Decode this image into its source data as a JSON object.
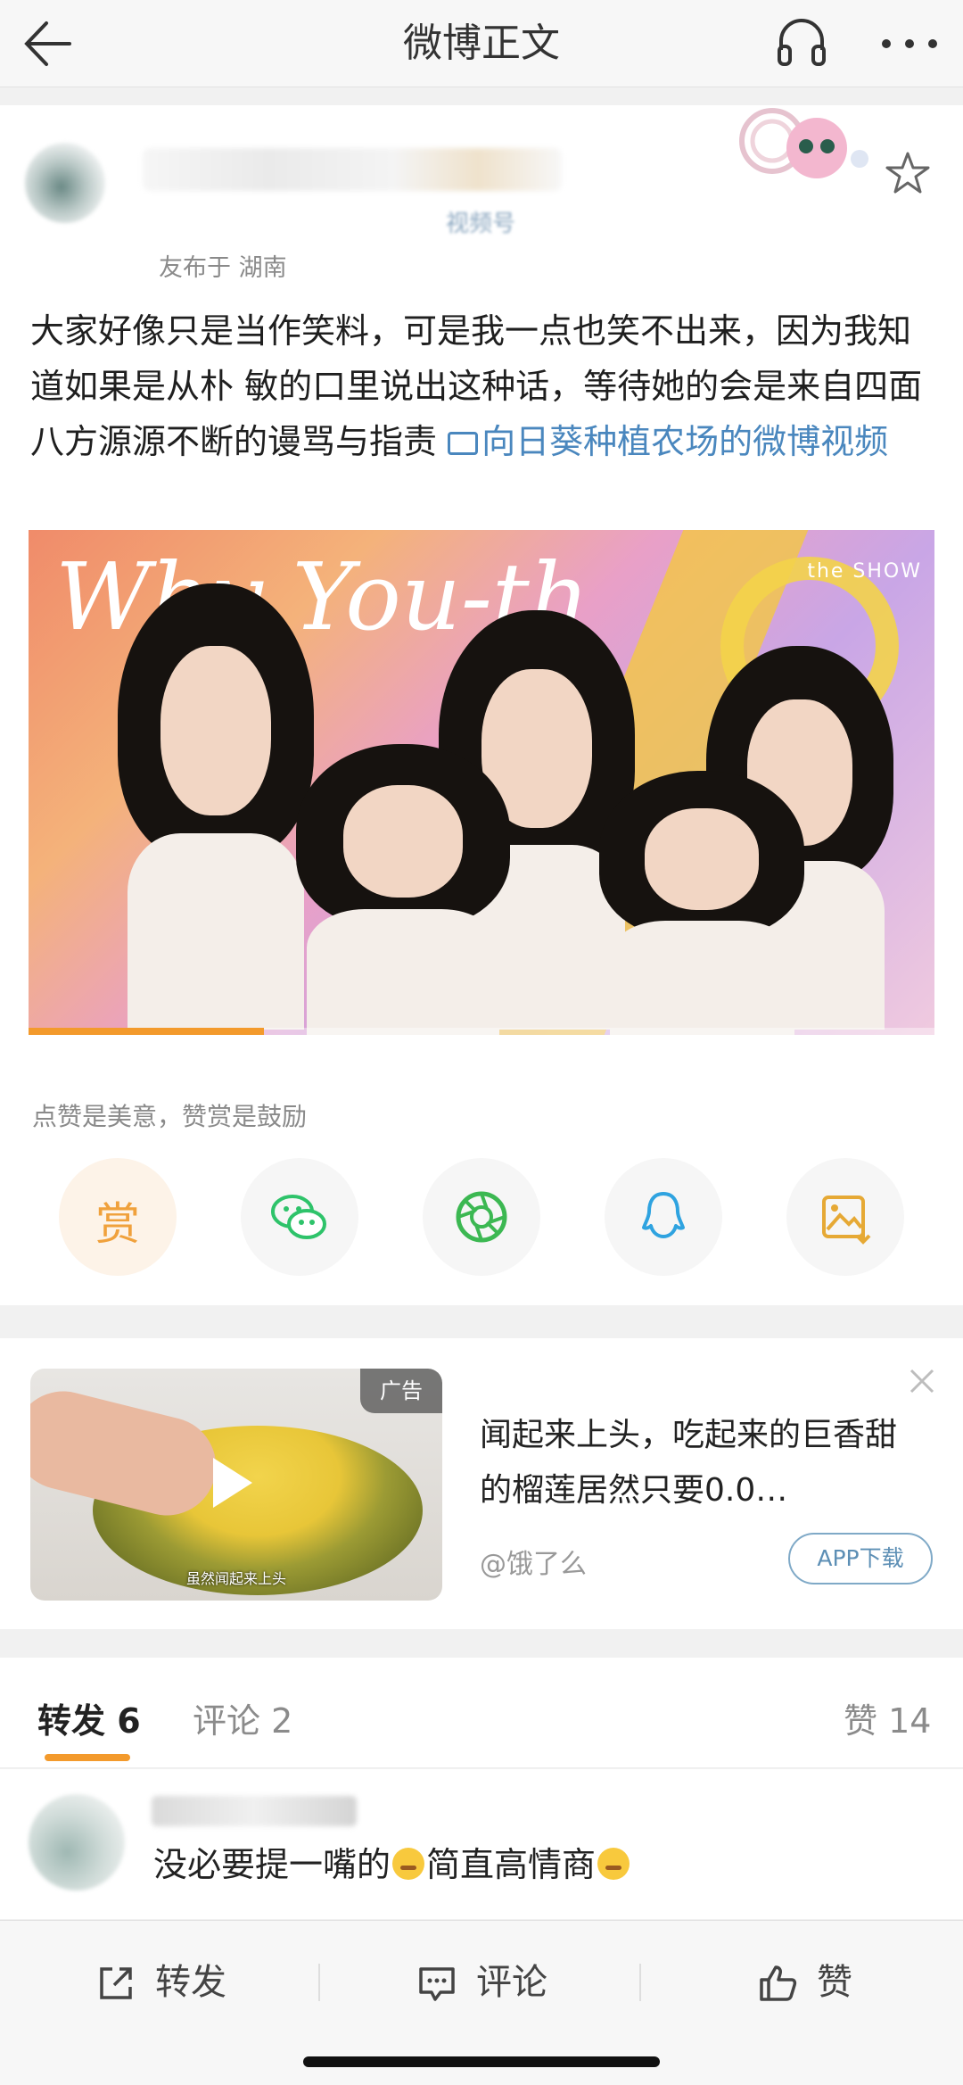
{
  "nav": {
    "title": "微博正文"
  },
  "post": {
    "meta_visible": "友布于 湖南",
    "source_partial": "视频号",
    "content_text": "大家好像只是当作笑料，可是我一点也笑不出来，因为我知道如果是从朴  敏的口里说出这种话，等待她的会是来自四面八方源源不断的谩骂与指责 ",
    "video_link": "向日葵种植农场的微博视频",
    "photo_sign": "Why You-th",
    "photo_badge": "the SHOW",
    "video_progress": 0.26,
    "appreciate_text": "点赞是美意，赞赏是鼓励",
    "reward_label": "赏"
  },
  "share_icons": [
    "reward-icon",
    "wechat-icon",
    "moments-icon",
    "qq-icon",
    "save-image-icon"
  ],
  "ad": {
    "tag": "广告",
    "caption": "虽然闻起来上头",
    "text": "闻起来上头，吃起来的巨香甜的榴莲居然只要0.0…",
    "brand": "@饿了么",
    "button": "APP下载"
  },
  "tabs": {
    "repost": "转发 6",
    "comments": "评论 2",
    "likes": "赞 14"
  },
  "comment": {
    "text_a": "没必要提一嘴的",
    "text_b": "简直高情商"
  },
  "bottom": {
    "repost": "转发",
    "comment": "评论",
    "like": "赞"
  },
  "colors": {
    "accent": "#f39a2c",
    "link": "#4a87be"
  }
}
